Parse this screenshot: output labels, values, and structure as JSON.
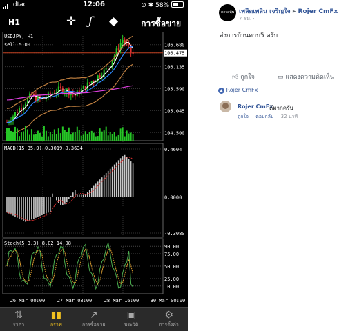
{
  "status_bar": {
    "carrier": "dtac",
    "time": "12:06",
    "battery": "58%",
    "battery_fraction": 0.58
  },
  "toolbar": {
    "timeframe": "H1",
    "trade_label": "การซื้อขาย",
    "icons": [
      "crosshair-icon",
      "function-icon",
      "objects-icon"
    ]
  },
  "chart": {
    "symbol_label": "USDJPY, H1",
    "sell_label": "sell 5.00",
    "price_labels": [
      "106.680",
      "106.475",
      "106.135",
      "105.590",
      "105.045",
      "104.500"
    ],
    "current_price": "106.475",
    "macd_label": "MACD(15,35,9) 0.3019 0.3634",
    "macd_levels": [
      "0.4604",
      "0.0000",
      "-0.3080"
    ],
    "stoch_label": "Stoch(5,3,3) 8.02 14.08",
    "stoch_levels": [
      "90.00",
      "75.00",
      "50.00",
      "25.00",
      "10.00"
    ],
    "time_labels": [
      "26 Mar 00:00",
      "27 Mar 08:00",
      "28 Mar 16:00",
      "30 Mar 00:00"
    ],
    "colors": {
      "bull": "#26c726",
      "bear": "#e03030",
      "ma_fast": "#ffffff",
      "ma_slow": "#2d89ff",
      "ma_long": "#e040e0",
      "bollinger": "#c08040",
      "stoch_main": "#4caf50",
      "stoch_signal": "#e0a030",
      "price_line": "#c04020"
    }
  },
  "tabbar": {
    "tabs": [
      {
        "label": "ราคา",
        "icon": "quotes-icon",
        "active": false
      },
      {
        "label": "กราฟ",
        "icon": "chart-icon",
        "active": true
      },
      {
        "label": "การซื้อขาย",
        "icon": "trade-icon",
        "active": false
      },
      {
        "label": "ประวัติ",
        "icon": "history-icon",
        "active": false
      },
      {
        "label": "การตั้งค่า",
        "icon": "settings-icon",
        "active": false
      }
    ]
  },
  "post": {
    "page_avatar_text": "ตลาดหุ้น",
    "page_name": "เพลิดเพลิน เจริญใจ",
    "arrow": "▸",
    "target_name": "Rojer CmFx",
    "time": "7 ชม.",
    "audience": "·",
    "text": "ส่งการบ้านคาบ5 ครับ",
    "like_label": "ถูกใจ",
    "comment_label": "แสดงความคิดเห็น",
    "liked_by": "Rojer CmFx",
    "comment": {
      "author": "Rojer CmFx",
      "text": "ดีมากครับ",
      "like": "ถูกใจ",
      "reply": "ตอบกลับ",
      "time": "32 นาที"
    }
  }
}
